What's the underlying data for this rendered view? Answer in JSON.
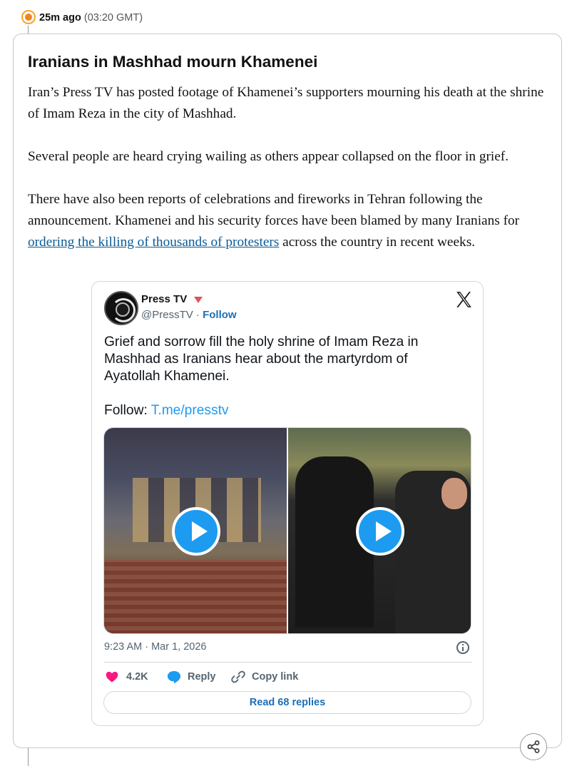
{
  "timeline": {
    "time_ago": "25m ago",
    "time_gmt": "(03:20 GMT)"
  },
  "post": {
    "headline": "Iranians in Mashhad mourn Khamenei",
    "paragraph1": "Iran’s Press TV has posted footage of Khamenei’s supporters mourning his death at the shrine of Imam Reza in the city of Mashhad.",
    "paragraph2": "Several people are heard crying wailing as others appear collapsed on the floor in grief.",
    "paragraph3_before": "There have also been reports of celebrations and fireworks in Tehran following the announcement. Khamenei and his security forces have been blamed by many Iranians for ",
    "paragraph3_link": "ordering the killing of thousands of protesters",
    "paragraph3_after": " across the country in recent weeks."
  },
  "tweet": {
    "account_name": "Press TV",
    "handle": "@PressTV",
    "separator": " · ",
    "follow_label": "Follow",
    "text": "Grief and sorrow fill the holy shrine of Imam Reza in Mashhad as Iranians hear about the martyrdom of Ayatollah Khamenei.",
    "follow_prefix": "Follow: ",
    "follow_link": "T.me/presstv",
    "timestamp": "9:23 AM · Mar 1, 2026",
    "likes": "4.2K",
    "reply_label": "Reply",
    "copy_label": "Copy link",
    "read_replies": "Read 68 replies"
  },
  "colors": {
    "accent": "#1d9bf0",
    "link": "#0a5a96",
    "live_dot": "#f58220",
    "heart": "#f91880"
  },
  "icons": [
    "live-dot-icon",
    "x-logo-icon",
    "play-icon",
    "info-icon",
    "heart-icon",
    "reply-bubble-icon",
    "link-icon",
    "share-icon"
  ]
}
